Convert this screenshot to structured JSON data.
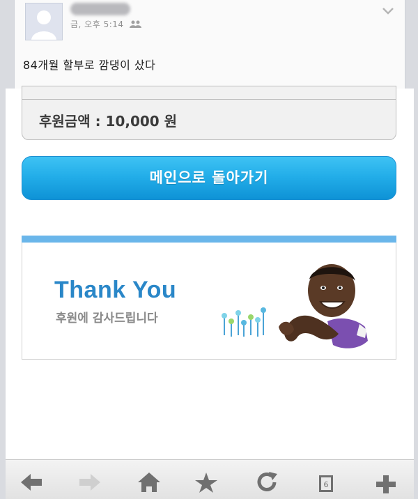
{
  "post": {
    "time": "금, 오후 5:14",
    "text": "84개월 할부로 깜댕이 샀다"
  },
  "phone": {
    "amount_text": "후원금액 : 10,000 원",
    "main_button_label": "메인으로 돌아가기",
    "banner": {
      "title": "Thank You",
      "subtitle": "후원에 감사드립니다"
    },
    "toolbar": {
      "tabs_count": "6"
    }
  },
  "colors": {
    "button_blue": "#23aee9",
    "banner_title_blue": "#2a87c8",
    "banner_bar": "#6ab6ea"
  },
  "icons": [
    "avatar-placeholder-icon",
    "friends-icon",
    "chevron-down-icon",
    "back-arrow-icon",
    "forward-arrow-icon",
    "home-icon",
    "star-icon",
    "reload-icon",
    "tabs-icon",
    "add-icon"
  ]
}
